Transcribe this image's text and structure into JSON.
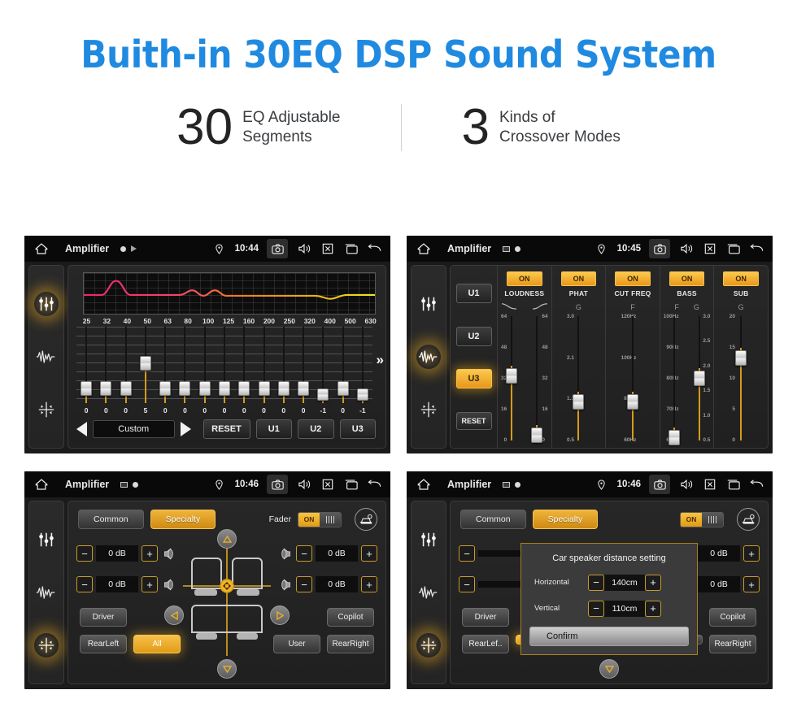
{
  "hero": {
    "title": "Buith-in 30EQ DSP Sound System"
  },
  "stats": [
    {
      "number": "30",
      "line1": "EQ Adjustable",
      "line2": "Segments"
    },
    {
      "number": "3",
      "line1": "Kinds of",
      "line2": "Crossover Modes"
    }
  ],
  "colors": {
    "accent_blue": "#1f8ae0",
    "accent_orange": "#e8971b",
    "panel_bg": "#1b1b1b",
    "slider_fill": "#d59b1c"
  },
  "panel_eq": {
    "statusbar": {
      "title": "Amplifier",
      "time": "10:44",
      "icons": [
        "home-icon",
        "record-dot-icon",
        "play-triangle-icon",
        "location-pin-icon",
        "camera-icon",
        "volume-icon",
        "close-box-icon",
        "recents-icon",
        "back-arrow-icon"
      ]
    },
    "rail": [
      "equalizer-icon",
      "waveform-icon",
      "balance-icon"
    ],
    "graph": {
      "label": "eq-response-curve"
    },
    "frequencies": [
      "25",
      "32",
      "40",
      "50",
      "63",
      "80",
      "100",
      "125",
      "160",
      "200",
      "250",
      "320",
      "400",
      "500",
      "630"
    ],
    "values": [
      "0",
      "0",
      "0",
      "5",
      "0",
      "0",
      "0",
      "0",
      "0",
      "0",
      "0",
      "0",
      "-1",
      "0",
      "-1"
    ],
    "knob_pct": [
      62,
      62,
      62,
      33,
      62,
      62,
      62,
      62,
      62,
      62,
      62,
      62,
      70,
      62,
      70
    ],
    "preset": "Custom",
    "reset_label": "RESET",
    "user_presets": [
      "U1",
      "U2",
      "U3"
    ],
    "more_chevron": "»"
  },
  "panel_crossover": {
    "statusbar": {
      "title": "Amplifier",
      "time": "10:45"
    },
    "presets": [
      "U1",
      "U2",
      "U3"
    ],
    "active_preset": "U3",
    "reset_label": "RESET",
    "sections": [
      {
        "name": "LOUDNESS",
        "toggle": "ON",
        "headers": [
          "curve-a",
          "curve-b"
        ],
        "sliders": [
          {
            "scale_left": [
              "64",
              "48",
              "32",
              "16",
              "0"
            ],
            "scale_right": [],
            "knob_pct": 42,
            "fill_pct": 58
          },
          {
            "scale_left": [],
            "scale_right": [
              "64",
              "48",
              "32",
              "16",
              "0"
            ],
            "knob_pct": 88,
            "fill_pct": 12
          }
        ]
      },
      {
        "name": "PHAT",
        "toggle": "ON",
        "headers": [
          "G"
        ],
        "sliders": [
          {
            "scale_left": [
              "3.0",
              "2.1",
              "1.3",
              "0.5"
            ],
            "scale_right": [],
            "knob_pct": 62,
            "fill_pct": 38
          }
        ]
      },
      {
        "name": "CUT FREQ",
        "toggle": "ON",
        "headers": [
          "F"
        ],
        "sliders": [
          {
            "scale_left": [
              "120Hz",
              "100Hz",
              "80Hz",
              "60Hz"
            ],
            "scale_right": [],
            "knob_pct": 62,
            "fill_pct": 38
          }
        ]
      },
      {
        "name": "BASS",
        "toggle": "ON",
        "headers": [
          "F",
          "G"
        ],
        "sliders": [
          {
            "scale_left": [
              "100Hz",
              "90Hz",
              "80Hz",
              "70Hz",
              "60Hz"
            ],
            "scale_right": [],
            "knob_pct": 90,
            "fill_pct": 10
          },
          {
            "scale_left": [],
            "scale_right": [
              "3.0",
              "2.5",
              "2.0",
              "1.5",
              "1.0",
              "0.5"
            ],
            "knob_pct": 44,
            "fill_pct": 56
          }
        ]
      },
      {
        "name": "SUB",
        "toggle": "ON",
        "headers": [
          "G"
        ],
        "sliders": [
          {
            "scale_left": [
              "20",
              "15",
              "10",
              "5",
              "0"
            ],
            "scale_right": [],
            "knob_pct": 28,
            "fill_pct": 72
          }
        ]
      }
    ]
  },
  "panel_balance": {
    "statusbar": {
      "title": "Amplifier",
      "time": "10:46"
    },
    "tabs": [
      {
        "label": "Common",
        "active": false
      },
      {
        "label": "Specialty",
        "active": true
      }
    ],
    "fader_label": "Fader",
    "fader_toggle": "ON",
    "car_setting_icon": "car-settings-icon",
    "db_controls": [
      {
        "position": "front-left",
        "value": "0 dB",
        "minus": "−",
        "plus": "+"
      },
      {
        "position": "rear-left",
        "value": "0 dB",
        "minus": "−",
        "plus": "+"
      },
      {
        "position": "front-right",
        "value": "0 dB",
        "minus": "−",
        "plus": "+"
      },
      {
        "position": "rear-right",
        "value": "0 dB",
        "minus": "−",
        "plus": "+"
      }
    ],
    "seat_buttons": [
      {
        "label": "Driver",
        "active": false
      },
      {
        "label": "Copilot",
        "active": false
      },
      {
        "label": "RearLeft",
        "active": false
      },
      {
        "label": "All",
        "active": true
      },
      {
        "label": "User",
        "active": false
      },
      {
        "label": "RearRight",
        "active": false
      }
    ]
  },
  "panel_dialog": {
    "statusbar": {
      "title": "Amplifier",
      "time": "10:46"
    },
    "tabs": [
      {
        "label": "Common",
        "active": false
      },
      {
        "label": "Specialty",
        "active": true
      }
    ],
    "fader_toggle": "ON",
    "dialog": {
      "title": "Car speaker distance setting",
      "rows": [
        {
          "label": "Horizontal",
          "value": "140cm",
          "minus": "−",
          "plus": "+"
        },
        {
          "label": "Vertical",
          "value": "110cm",
          "minus": "−",
          "plus": "+"
        }
      ],
      "confirm_label": "Confirm"
    },
    "db_controls": [
      {
        "value": "0 dB"
      },
      {
        "value": "0 dB"
      }
    ],
    "seat_buttons": [
      {
        "label": "Driver"
      },
      {
        "label": "Copilot"
      },
      {
        "label": "RearLef.."
      },
      {
        "label": "RearRight"
      }
    ]
  }
}
